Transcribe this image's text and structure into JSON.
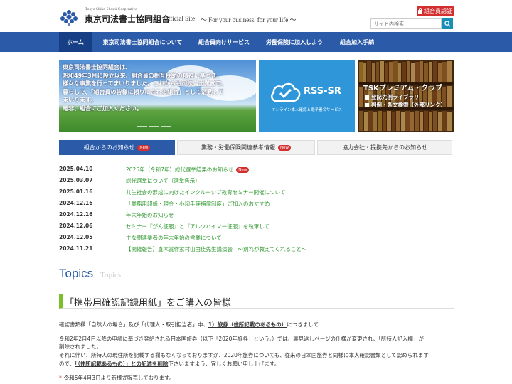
{
  "header": {
    "org_name": "東京司法書士協同組合",
    "org_name_en": "Tokyo Shiho-Shoshi Cooperative",
    "official": "Official Site",
    "tagline": "〜 For your business, for your life 〜",
    "member_login": "組合員認証",
    "search_placeholder": "サイト内検索"
  },
  "nav": [
    {
      "label": "ホーム",
      "active": true
    },
    {
      "label": "東京司法書士協同組合について"
    },
    {
      "label": "組合員向けサービス"
    },
    {
      "label": "労働保険に加入しよう"
    },
    {
      "label": "組合加入手続"
    }
  ],
  "hero": {
    "lines": [
      "東京司法書士協同組合は、",
      "昭和49年3月に設立以来、組合員の相互扶助の精神に基づき、",
      "様々な事業を行ってまいりました。これからも司法書士業務で、",
      "暮らしで、「組合員の皆様に頼りにされる組合」として活動して",
      "まいります。",
      "是非、組合にご加入ください。"
    ]
  },
  "rss_banner": {
    "title": "RSS-SR",
    "subtitle": "オンライン本人確認＆電子署名サービス"
  },
  "tsk_banner": {
    "title": "TSKプレミアム・クラブ",
    "items": [
      "登記先例ライブラリ",
      "判例・条文検索（外部リンク）"
    ]
  },
  "tabs": [
    {
      "label": "組合からのお知らせ",
      "badge": "New",
      "active": true
    },
    {
      "label": "業務・労働保険関連参考情報",
      "badge": "New"
    },
    {
      "label": "協力会社・提携先からのお知らせ"
    }
  ],
  "news": [
    {
      "date": "2025.04.10",
      "title": "2025年（令和7年）総代選挙結果のお知らせ",
      "badge": "New"
    },
    {
      "date": "2025.03.07",
      "title": "総代選挙について（選挙告示）"
    },
    {
      "date": "2025.01.16",
      "title": "共生社会の形成に向けたインクルーシブ教育セミナー開催について"
    },
    {
      "date": "2024.12.16",
      "title": "「業務用印紙・現金・小切手等補償制度」ご加入のおすすめ"
    },
    {
      "date": "2024.12.16",
      "title": "年末年始のお知らせ"
    },
    {
      "date": "2024.12.06",
      "title": "セミナー『がん征服』と『アルツハイマー征服』を執筆して"
    },
    {
      "date": "2024.12.05",
      "title": "主な関連業者の年末年始の営業について"
    },
    {
      "date": "2024.11.21",
      "title": "【開催報告】直木賞作家村山由佳先生講演会　〜別れが教えてくれること〜"
    }
  ],
  "topics": {
    "heading": "Topics",
    "heading_en": "Topics",
    "article_title": "「携帯用確認記録用紙」をご購入の皆様",
    "p1_a": "確認書類欄「自然人の場合」及び「代理人・取引担当者」中、",
    "p1_b": "1）旅券（住所記載のあるもの）",
    "p1_c": "につきまして",
    "p2_1": "令和2年2月4日以降の申請に基づき発給される日本国旅券（以下「2020年旅券」という。）では、裏見返しページの仕様が変更され、「所持人記入欄」が",
    "p2_2": "削除されました。",
    "p3_1": "それに伴い、所持人の現住所を記載する欄もなくなっておりますが、2020年旅券についても、従来の日本国旅券と同様に本人確認書類として認められます",
    "p3_2a": "ので、",
    "p3_2b": "「（住所記載あるもの）」との記述を削除",
    "p3_2c": "下さいますよう、宜しくお願い申し上げます。",
    "p4": "令和5年4月3日より新様式販売しております。"
  }
}
